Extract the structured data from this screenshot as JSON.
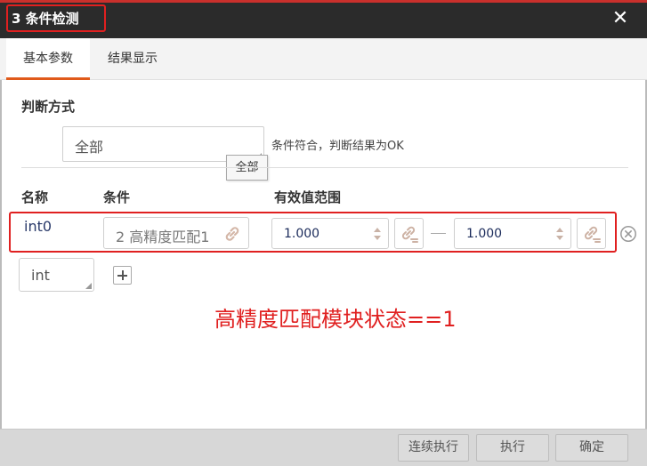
{
  "dialog": {
    "title": "3 条件检测",
    "close_symbol": "✕"
  },
  "tabs": [
    {
      "label": "基本参数",
      "active": true
    },
    {
      "label": "结果显示",
      "active": false
    }
  ],
  "judge": {
    "label": "判断方式",
    "value": "全部",
    "hint": "条件符合，判断结果为OK",
    "tooltip": "全部"
  },
  "table": {
    "headers": {
      "name": "名称",
      "condition": "条件",
      "range": "有效值范围"
    },
    "rows": [
      {
        "name": "int0",
        "condition": "2 高精度匹配1",
        "min": "1.000",
        "max": "1.000"
      }
    ]
  },
  "new_row": {
    "type": "int"
  },
  "annotation": "高精度匹配模块状态==1",
  "footer": {
    "continuous_run": "连续执行",
    "run": "执行",
    "confirm": "确定"
  },
  "colors": {
    "accent": "#e05a1a",
    "highlight_red": "#e02020",
    "titlebar": "#2b2b2b"
  },
  "icons": [
    "close-icon",
    "corner-resize-icon",
    "link-icon",
    "spinner-icon",
    "link-bind-icon",
    "remove-circle-icon",
    "plus-icon"
  ]
}
